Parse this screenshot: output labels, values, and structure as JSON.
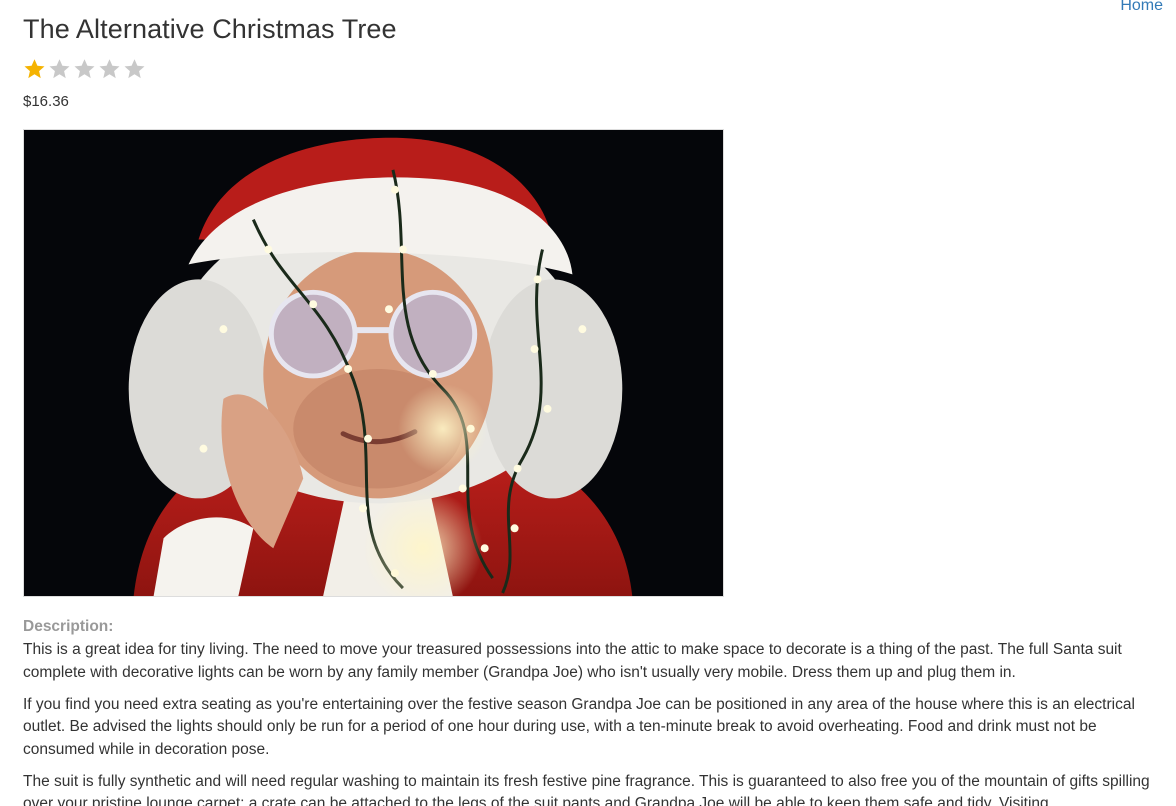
{
  "nav": {
    "home_label": "Home"
  },
  "product": {
    "title": "The Alternative Christmas Tree",
    "rating": 1,
    "rating_max": 5,
    "star_color_on": "#f5b301",
    "star_color_off": "#c8c8c8",
    "price": "$16.36",
    "description_label": "Description:",
    "paragraphs": [
      "This is a great idea for tiny living. The need to move your treasured possessions into the attic to make space to decorate is a thing of the past. The full Santa suit complete with decorative lights can be worn by any family member (Grandpa Joe) who isn't usually very mobile. Dress them up and plug them in.",
      "If you find you need extra seating as you're entertaining over the festive season Grandpa Joe can be positioned in any area of the house where this is an electrical outlet. Be advised the lights should only be run for a period of one hour during use, with a ten-minute break to avoid overheating. Food and drink must not be consumed while in decoration pose.",
      "The suit is fully synthetic and will need regular washing to maintain its fresh festive pine fragrance. This is guaranteed to also free you of the mountain of gifts spilling over your pristine lounge carpet; a crate can be attached to the legs of the suit pants and Grandpa Joe will be able to keep them safe and tidy. Visiting"
    ]
  }
}
